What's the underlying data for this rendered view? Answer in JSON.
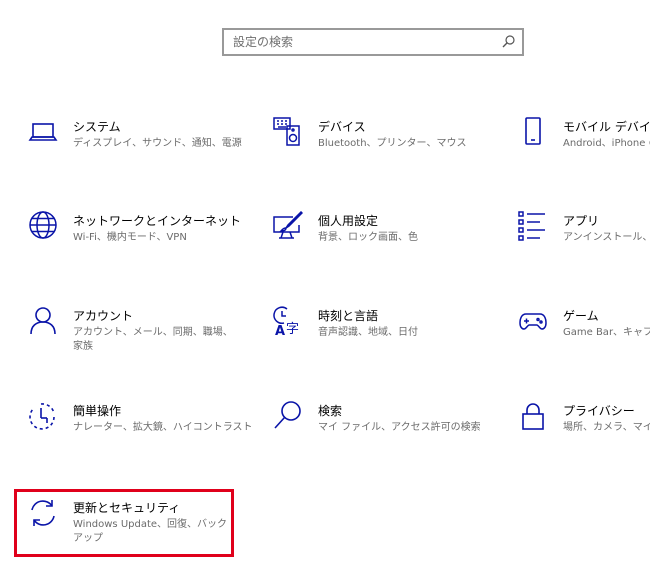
{
  "search": {
    "placeholder": "設定の検索"
  },
  "colors": {
    "accent": "#0a14a8",
    "highlight": "#e0001b"
  },
  "tiles": {
    "system": {
      "title": "システム",
      "desc": "ディスプレイ、サウンド、通知、電源",
      "icon": "laptop-icon"
    },
    "devices": {
      "title": "デバイス",
      "desc": "Bluetooth、プリンター、マウス",
      "icon": "keyboard-speaker-icon"
    },
    "mobile": {
      "title": "モバイル デバイス",
      "desc": "Android、iPhone の",
      "icon": "phone-icon"
    },
    "network": {
      "title": "ネットワークとインターネット",
      "desc": "Wi-Fi、機内モード、VPN",
      "icon": "globe-icon"
    },
    "personal": {
      "title": "個人用設定",
      "desc": "背景、ロック画面、色",
      "icon": "paint-monitor-icon"
    },
    "apps": {
      "title": "アプリ",
      "desc": "アンインストール、既",
      "icon": "app-list-icon"
    },
    "accounts": {
      "title": "アカウント",
      "desc": "アカウント、メール、同期、職場、家族",
      "icon": "person-icon"
    },
    "time": {
      "title": "時刻と言語",
      "desc": "音声認識、地域、日付",
      "icon": "time-language-icon"
    },
    "gaming": {
      "title": "ゲーム",
      "desc": "Game Bar、キャプチ",
      "icon": "gamepad-icon"
    },
    "ease": {
      "title": "簡単操作",
      "desc": "ナレーター、拡大鏡、ハイコントラスト",
      "icon": "ease-of-access-icon"
    },
    "searchcat": {
      "title": "検索",
      "desc": "マイ ファイル、アクセス許可の検索",
      "icon": "magnifier-icon"
    },
    "privacy": {
      "title": "プライバシー",
      "desc": "場所、カメラ、マイク",
      "icon": "lock-icon"
    },
    "update": {
      "title": "更新とセキュリティ",
      "desc": "Windows Update、回復、バックアップ",
      "icon": "sync-arrows-icon"
    }
  }
}
